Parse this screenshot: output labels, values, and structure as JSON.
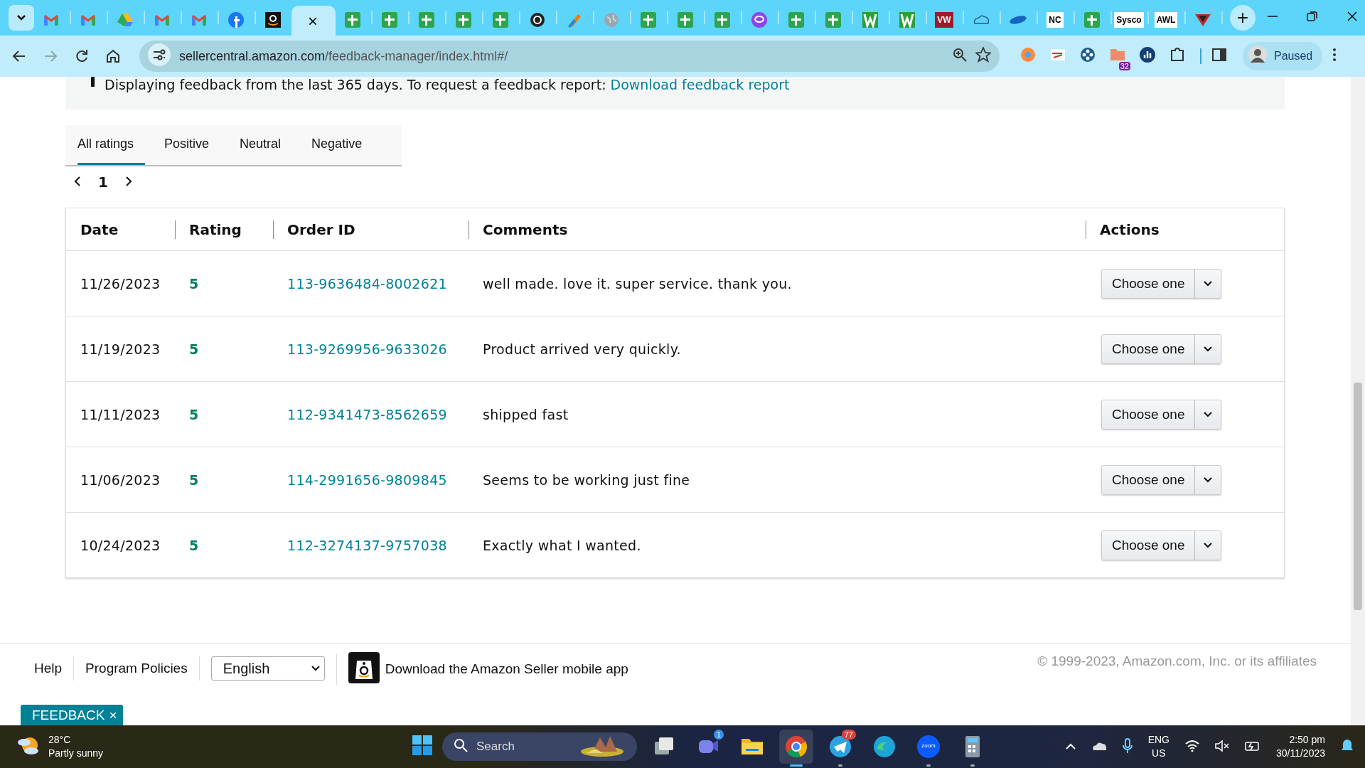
{
  "browser": {
    "tabs": [
      {
        "kind": "menu",
        "selected": false
      },
      {
        "kind": "gmail",
        "selected": false
      },
      {
        "kind": "gmail",
        "selected": false
      },
      {
        "kind": "drive",
        "selected": false
      },
      {
        "kind": "gmail",
        "selected": false
      },
      {
        "kind": "gmail",
        "selected": false
      },
      {
        "kind": "facebook",
        "selected": false
      },
      {
        "kind": "amazon",
        "selected": false
      },
      {
        "kind": "current",
        "selected": true,
        "close": "×"
      },
      {
        "kind": "sheets",
        "selected": false
      },
      {
        "kind": "sheets",
        "selected": false
      },
      {
        "kind": "sheets",
        "selected": false
      },
      {
        "kind": "sheets",
        "selected": false
      },
      {
        "kind": "sheets",
        "selected": false
      },
      {
        "kind": "circle",
        "selected": false
      },
      {
        "kind": "pen",
        "selected": false
      },
      {
        "kind": "globe",
        "selected": false
      },
      {
        "kind": "sheets",
        "selected": false
      },
      {
        "kind": "sheets",
        "selected": false
      },
      {
        "kind": "sheets",
        "selected": false
      },
      {
        "kind": "chat",
        "selected": false
      },
      {
        "kind": "sheets",
        "selected": false
      },
      {
        "kind": "sheets",
        "selected": false
      },
      {
        "kind": "w",
        "selected": false
      },
      {
        "kind": "w",
        "selected": false
      },
      {
        "kind": "text",
        "selected": false,
        "text": "VW",
        "color": "#9b1b2a"
      },
      {
        "kind": "cloud",
        "selected": false
      },
      {
        "kind": "swoosh",
        "selected": false
      },
      {
        "kind": "text",
        "selected": false,
        "text": "NC",
        "color": "#ffffff"
      },
      {
        "kind": "sheets",
        "selected": false
      },
      {
        "kind": "text",
        "selected": false,
        "text": "Sysco",
        "color": "#ffffff"
      },
      {
        "kind": "text",
        "selected": false,
        "text": "AWL",
        "color": "#ffffff"
      },
      {
        "kind": "shield",
        "selected": false
      }
    ],
    "new_tab": "+",
    "address_host": "sellercentral.amazon.com",
    "address_path": "/feedback-manager/index.html#/",
    "extensions": [
      {
        "kind": "orange"
      },
      {
        "kind": "login"
      },
      {
        "kind": "dots"
      },
      {
        "kind": "folder",
        "badge": "32"
      },
      {
        "kind": "chart"
      },
      {
        "kind": "puzzle"
      }
    ],
    "profile": {
      "label": "Paused"
    }
  },
  "notice": {
    "text": "Displaying feedback from the last 365 days. To request a feedback report: ",
    "link": "Download feedback report"
  },
  "rating_tabs": [
    {
      "label": "All ratings",
      "selected": true
    },
    {
      "label": "Positive",
      "selected": false
    },
    {
      "label": "Neutral",
      "selected": false
    },
    {
      "label": "Negative",
      "selected": false
    }
  ],
  "pager": {
    "page": "1"
  },
  "table": {
    "columns": [
      "Date",
      "Rating",
      "Order ID",
      "Comments",
      "Actions"
    ],
    "rows": [
      {
        "date": "11/26/2023",
        "rating": "5",
        "order_id": "113-9636484-8002621",
        "comment": "well made. love it. super service. thank you.",
        "action": "Choose one"
      },
      {
        "date": "11/19/2023",
        "rating": "5",
        "order_id": "113-9269956-9633026",
        "comment": "Product arrived very quickly.",
        "action": "Choose one"
      },
      {
        "date": "11/11/2023",
        "rating": "5",
        "order_id": "112-9341473-8562659",
        "comment": "shipped fast",
        "action": "Choose one"
      },
      {
        "date": "11/06/2023",
        "rating": "5",
        "order_id": "114-2991656-9809845",
        "comment": "Seems to be working just fine",
        "action": "Choose one"
      },
      {
        "date": "10/24/2023",
        "rating": "5",
        "order_id": "112-3274137-9757038",
        "comment": "Exactly what I wanted.",
        "action": "Choose one"
      }
    ]
  },
  "footer": {
    "links": [
      "Help",
      "Program Policies"
    ],
    "language": "English",
    "app_link": "Download the Amazon Seller mobile app",
    "copyright": "© 1999-2023, Amazon.com, Inc. or its affiliates"
  },
  "feedback_tab": {
    "label": "FEEDBACK",
    "close": "×"
  },
  "taskbar": {
    "weather": {
      "temp": "28°C",
      "condition": "Partly sunny"
    },
    "search": {
      "placeholder": "Search"
    },
    "apps": [
      {
        "kind": "taskview",
        "running": false,
        "focused": false
      },
      {
        "kind": "teams",
        "badge": "1",
        "running": false,
        "focused": false
      },
      {
        "kind": "explorer",
        "running": false,
        "focused": false
      },
      {
        "kind": "chrome",
        "running": true,
        "focused": true
      },
      {
        "kind": "telegram",
        "badge": "77",
        "running": true,
        "focused": false
      },
      {
        "kind": "edge",
        "running": false,
        "focused": false
      },
      {
        "kind": "zoom",
        "text": "zoom",
        "running": true,
        "focused": false
      },
      {
        "kind": "calculator",
        "running": true,
        "focused": false
      }
    ],
    "tray": {
      "language": "ENG",
      "region": "US",
      "time": "2:50 pm",
      "date": "30/11/2023"
    }
  }
}
